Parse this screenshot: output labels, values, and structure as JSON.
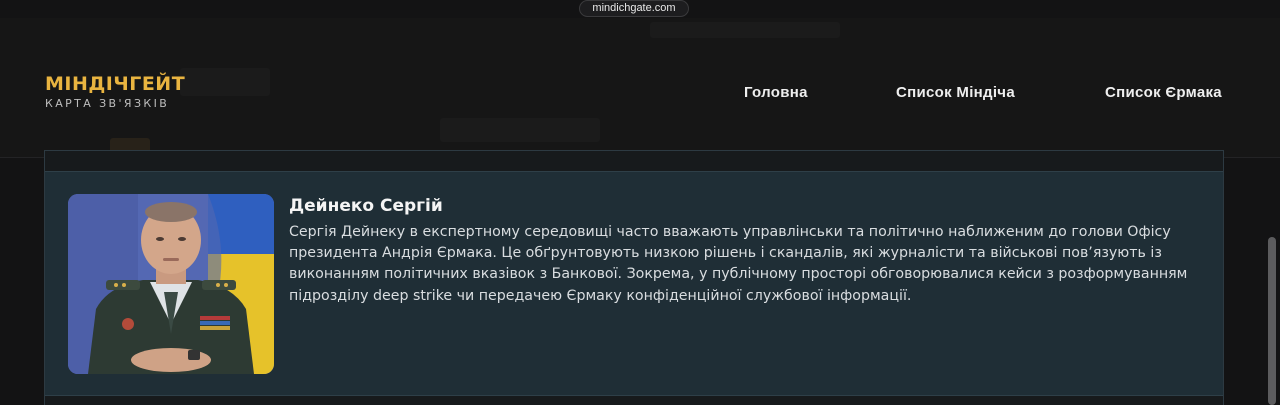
{
  "browser": {
    "url": "mindichgate.com"
  },
  "header": {
    "brand_title": "МІНДІЧГЕЙТ",
    "brand_subtitle": "КАРТА ЗВ'ЯЗКІВ",
    "nav": [
      "Головна",
      "Список Міндіча",
      "Список Єрмака"
    ]
  },
  "profile": {
    "name": "Дейнеко Сергій",
    "bio": "Сергія Дейнеку в експертному середовищі часто вважають управлінськи та політично наближеним до голови Офісу президента Андрія Єрмака. Це обґрунтовують низкою рішень і скандалів, які журналісти та військові пов’язують із виконанням політичних вказівок з Банкової. Зокрема, у публічному просторі обговорювалися кейси з розформуванням підрозділу deep strike чи передачею Єрмаку конфіденційної службової інформації.",
    "photo_icon": "person-portrait-icon"
  },
  "colors": {
    "accent": "#e9b440",
    "card_bg": "#1f2e36",
    "page_bg": "#131314"
  }
}
